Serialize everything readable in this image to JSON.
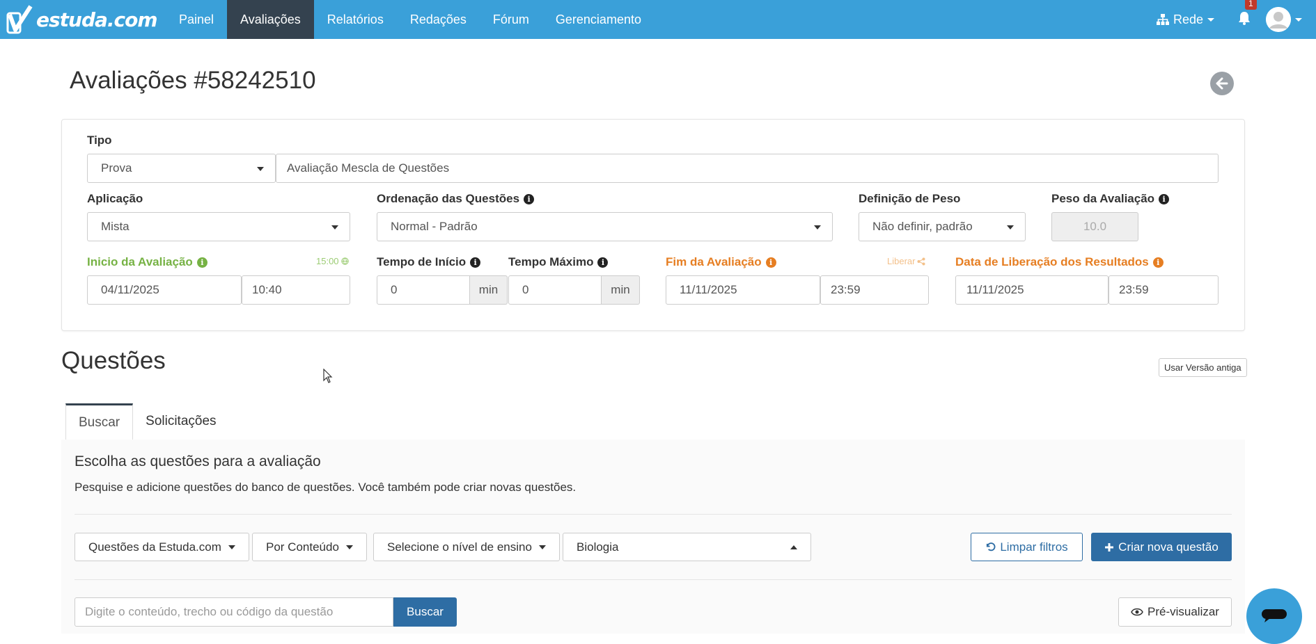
{
  "brand": {
    "logo_text": "estuda.com",
    "accent": "#3aa0d9",
    "nav_active_bg": "#34424f"
  },
  "nav": {
    "items": [
      {
        "label": "Painel",
        "active": false
      },
      {
        "label": "Avaliações",
        "active": true
      },
      {
        "label": "Relatórios",
        "active": false
      },
      {
        "label": "Redações",
        "active": false
      },
      {
        "label": "Fórum",
        "active": false
      },
      {
        "label": "Gerenciamento",
        "active": false
      }
    ],
    "rede_label": "Rede",
    "notification_count": "1"
  },
  "page": {
    "title": "Avaliações #58242510"
  },
  "form": {
    "tipo": {
      "label": "Tipo",
      "value": "Prova",
      "name_value": "Avaliação Mescla de Questões"
    },
    "aplicacao": {
      "label": "Aplicação",
      "value": "Mista"
    },
    "ordenacao": {
      "label": "Ordenação das Questões",
      "value": "Normal - Padrão"
    },
    "definicao_peso": {
      "label": "Definição de Peso",
      "value": "Não definir, padrão"
    },
    "peso": {
      "label": "Peso da Avaliação",
      "value": "10.0"
    },
    "inicio": {
      "label": "Inicio da Avaliação",
      "hint": "15:00",
      "date": "04/11/2025",
      "time": "10:40"
    },
    "tempo_inicio": {
      "label": "Tempo de Início",
      "value": "0",
      "unit": "min"
    },
    "tempo_maximo": {
      "label": "Tempo Máximo",
      "value": "0",
      "unit": "min"
    },
    "fim": {
      "label": "Fim da Avaliação",
      "hint": "Liberar",
      "date": "11/11/2025",
      "time": "23:59"
    },
    "liberacao": {
      "label": "Data de Liberação dos Resultados",
      "date": "11/11/2025",
      "time": "23:59"
    }
  },
  "questoes": {
    "title": "Questões",
    "old_version_label": "Usar Versão antiga",
    "tabs": [
      {
        "label": "Buscar",
        "active": true
      },
      {
        "label": "Solicitações",
        "active": false
      }
    ],
    "heading": "Escolha as questões para a avaliação",
    "description": "Pesquise e adicione questões do banco de questões. Você também pode criar novas questões.",
    "filters": {
      "source": "Questões da Estuda.com",
      "mode": "Por Conteúdo",
      "level": "Selecione o nível de ensino",
      "subject": "Biologia"
    },
    "clear_filters_label": "Limpar filtros",
    "create_label": "Criar nova questão",
    "search_placeholder": "Digite o conteúdo, trecho ou código da questão",
    "search_button": "Buscar",
    "preview_label": "Pré-visualizar"
  }
}
